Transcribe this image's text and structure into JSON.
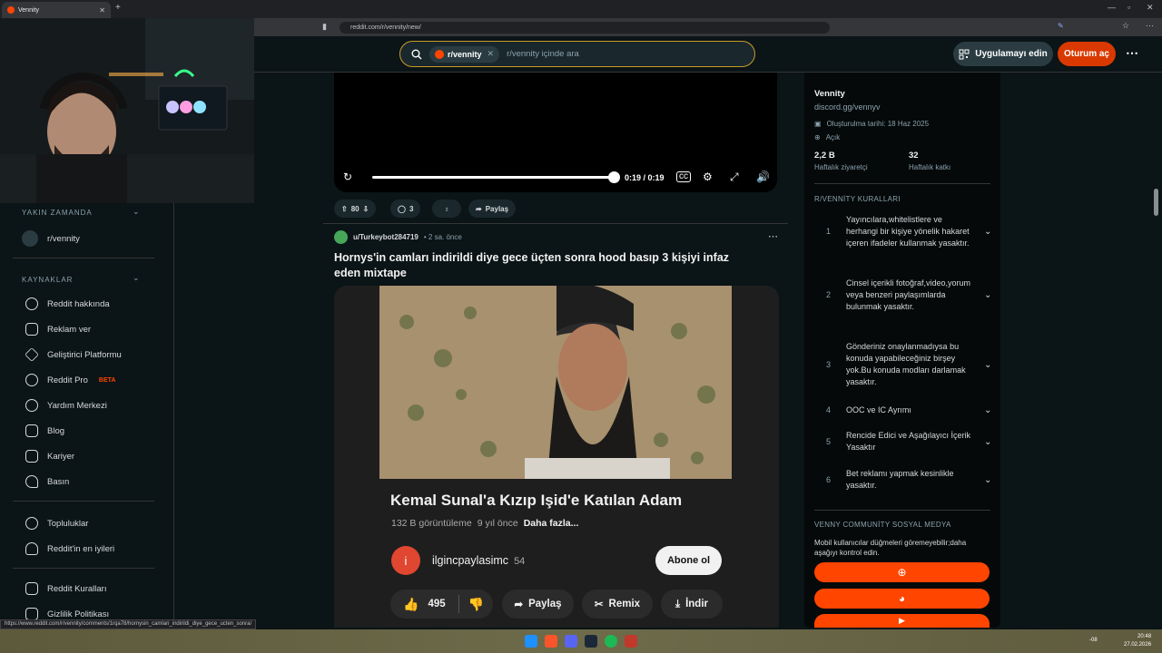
{
  "browser": {
    "tab_title": "Vennity",
    "url": "reddit.com/r/vennity/new/",
    "status_url": "https://www.reddit.com/r/vennity/comments/1rqa78/hornysin_camlari_indirildi_diye_gece_ucten_sonra/"
  },
  "header": {
    "search_chip": "r/vennity",
    "search_placeholder": "r/vennity içinde ara",
    "get_app": "Uygulamayı edin",
    "login": "Oturum aç"
  },
  "sidebar": {
    "recent_heading": "YAKIN ZAMANDA",
    "recent_items": [
      {
        "label": "r/vennity"
      }
    ],
    "resources_heading": "KAYNAKLAR",
    "resources": [
      {
        "label": "Reddit hakkında",
        "icon": "reddit-icon"
      },
      {
        "label": "Reklam ver",
        "icon": "megaphone-icon"
      },
      {
        "label": "Geliştirici Platformu",
        "icon": "developer-icon"
      },
      {
        "label": "Reddit Pro",
        "badge": "BETA",
        "icon": "pro-icon"
      },
      {
        "label": "Yardım Merkezi",
        "icon": "help-icon"
      },
      {
        "label": "Blog",
        "icon": "book-icon"
      },
      {
        "label": "Kariyer",
        "icon": "briefcase-icon"
      },
      {
        "label": "Basın",
        "icon": "microphone-icon"
      }
    ],
    "community_links": [
      {
        "label": "Topluluklar",
        "icon": "communities-icon"
      },
      {
        "label": "Reddit'in en iyileri",
        "icon": "award-icon"
      }
    ],
    "policy_links": [
      {
        "label": "Reddit Kuralları",
        "icon": "rules-icon"
      },
      {
        "label": "Gizlilik Politikası",
        "icon": "privacy-icon"
      }
    ]
  },
  "video_player": {
    "time": "0:19 / 0:19",
    "progress": 1.0
  },
  "prev_post_actions": {
    "votes": "80",
    "comments": "3",
    "share": "Paylaş"
  },
  "post": {
    "author": "u/Turkeybot284719",
    "time": "• 2 sa. önce",
    "title": "Hornys'in camları indirildi diye gece üçten sonra hood basıp 3 kişiyi infaz eden mixtape"
  },
  "youtube_embed": {
    "title": "Kemal Sunal'a Kızıp Işid'e Katılan Adam",
    "views": "132 B görüntüleme",
    "age": "9 yıl önce",
    "more": "Daha fazla...",
    "channel_initial": "i",
    "channel": "ilgincpaylasimc",
    "subs": "54",
    "subscribe": "Abone ol",
    "likes": "495",
    "share": "Paylaş",
    "remix": "Remix",
    "download": "İndir"
  },
  "right_sidebar": {
    "community_name": "Vennity",
    "discord": "discord.gg/vennyv",
    "created": "Oluşturulma tarihi: 18 Haz 2025",
    "visibility": "Açık",
    "weekly_visitors_value": "2,2 B",
    "weekly_visitors_label": "Haftalık ziyaretçi",
    "weekly_contrib_value": "32",
    "weekly_contrib_label": "Haftalık katkı",
    "rules_heading": "R/VENNİTY KURALLARI",
    "rules": [
      {
        "num": "1",
        "text": "Yayıncılara,whitelistlere ve herhangi bir kişiye yönelik hakaret içeren ifadeler kullanmak yasaktır."
      },
      {
        "num": "2",
        "text": "Cinsel içerikli fotoğraf,video,yorum veya benzeri paylaşımlarda bulunmak yasaktır."
      },
      {
        "num": "3",
        "text": "Gönderiniz onaylanmadıysa bu konuda yapabileceğiniz birşey yok.Bu konuda modları darlamak yasaktır."
      },
      {
        "num": "4",
        "text": "OOC ve IC Ayrımı"
      },
      {
        "num": "5",
        "text": "Rencide Edici ve Aşağılayıcı İçerik Yasaktır"
      },
      {
        "num": "6",
        "text": "Bet reklamı yapmak kesinlikle yasaktır."
      }
    ],
    "social_heading": "VENNY COMMUNİTY SOSYAL MEDYA",
    "social_note": "Mobil kullanıcılar düğmeleri göremeyebilir;daha aşağıyı kontrol edin."
  },
  "taskbar": {
    "time": "20:48",
    "date": "27.02.2026",
    "temp": "-08"
  },
  "colors": {
    "accent": "#ff4500",
    "login": "#d93900",
    "bg": "#0b1416"
  }
}
